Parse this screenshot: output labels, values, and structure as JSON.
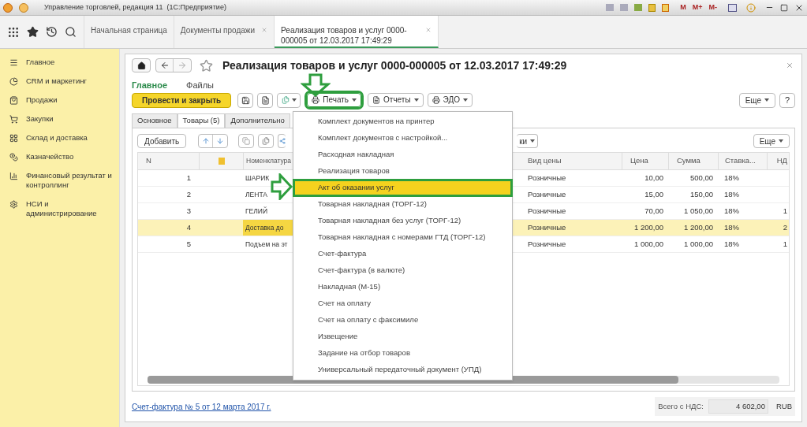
{
  "window": {
    "title": "Управление торговлей, редакция 11  (1С:Предприятие)",
    "memory_buttons": [
      "M",
      "M+",
      "M-"
    ]
  },
  "nav_tabs": [
    {
      "label": "Начальная страница",
      "selected": false,
      "closable": false
    },
    {
      "label": "Документы продажи",
      "selected": false,
      "closable": true
    },
    {
      "label": "Реализация товаров и услуг 0000-000005 от 12.03.2017 17:49:29",
      "selected": true,
      "closable": true
    }
  ],
  "sidebar": {
    "items": [
      {
        "label": "Главное"
      },
      {
        "label": "CRM и маркетинг"
      },
      {
        "label": "Продажи"
      },
      {
        "label": "Закупки"
      },
      {
        "label": "Склад и доставка"
      },
      {
        "label": "Казначейство"
      },
      {
        "label": "Финансовый результат и контроллинг"
      },
      {
        "label": "НСИ и администрирование"
      }
    ]
  },
  "document": {
    "title": "Реализация товаров и услуг 0000-000005 от 12.03.2017 17:49:29",
    "subtabs": [
      {
        "label": "Главное",
        "selected": true
      },
      {
        "label": "Файлы",
        "selected": false
      }
    ],
    "toolbar": {
      "primary": "Провести и закрыть",
      "menus": [
        {
          "label": "Печать",
          "highlighted": true
        },
        {
          "label": "Отчеты",
          "highlighted": false
        },
        {
          "label": "ЭДО",
          "highlighted": false
        }
      ],
      "more": "Еще",
      "help": "?"
    },
    "tabs": [
      {
        "label": "Основное",
        "selected": false
      },
      {
        "label": "Товары (5)",
        "selected": true
      },
      {
        "label": "Дополнительно",
        "selected": false
      }
    ],
    "table": {
      "add": "Добавить",
      "filter_tail": "ки",
      "more": "Еще",
      "columns": [
        "N",
        "Номенклатура",
        "Вид цены",
        "Цена",
        "Сумма",
        "Ставка...",
        "НД"
      ],
      "rows": [
        {
          "selected": false,
          "n": "1",
          "name": "ШАРИК",
          "price_type": "Розничные",
          "price": "10,00",
          "sum": "500,00",
          "rate": "18%"
        },
        {
          "selected": false,
          "n": "2",
          "name": "ЛЕНТА",
          "price_type": "Розничные",
          "price": "15,00",
          "sum": "150,00",
          "rate": "18%"
        },
        {
          "selected": false,
          "n": "3",
          "name": "ГЕЛИЙ",
          "price_type": "Розничные",
          "price": "70,00",
          "sum": "1 050,00",
          "rate": "18%",
          "vat": "1"
        },
        {
          "selected": true,
          "n": "4",
          "name": "Доставка до",
          "price_type": "Розничные",
          "price": "1 200,00",
          "sum": "1 200,00",
          "rate": "18%",
          "vat": "2"
        },
        {
          "selected": false,
          "n": "5",
          "name": "Подъем на эт",
          "price_type": "Розничные",
          "price": "1 000,00",
          "sum": "1 000,00",
          "rate": "18%",
          "vat": "1"
        }
      ]
    },
    "footer": {
      "link": "Счет-фактура № 5 от 12 марта 2017 г.",
      "total_label": "Всего с НДС:",
      "total": "4 602,00",
      "currency": "RUB"
    }
  },
  "print_menu": {
    "items": [
      {
        "label": "Комплект документов на принтер",
        "selected": false
      },
      {
        "label": "Комплект документов с настройкой...",
        "selected": false
      },
      {
        "label": "Расходная накладная",
        "selected": false
      },
      {
        "label": "Реализация товаров",
        "selected": false
      },
      {
        "label": "Акт об оказании услуг",
        "selected": true
      },
      {
        "label": "Товарная накладная (ТОРГ-12)",
        "selected": false
      },
      {
        "label": "Товарная накладная без услуг (ТОРГ-12)",
        "selected": false
      },
      {
        "label": "Товарная накладная с номерами ГТД (ТОРГ-12)",
        "selected": false
      },
      {
        "label": "Счет-фактура",
        "selected": false
      },
      {
        "label": "Счет-фактура (в валюте)",
        "selected": false
      },
      {
        "label": "Накладная (М-15)",
        "selected": false
      },
      {
        "label": "Счет на оплату",
        "selected": false
      },
      {
        "label": "Счет на оплату с факсимиле",
        "selected": false
      },
      {
        "label": "Извещение",
        "selected": false
      },
      {
        "label": "Задание на отбор товаров",
        "selected": false
      },
      {
        "label": "Универсальный передаточный документ (УПД)",
        "selected": false
      }
    ]
  }
}
